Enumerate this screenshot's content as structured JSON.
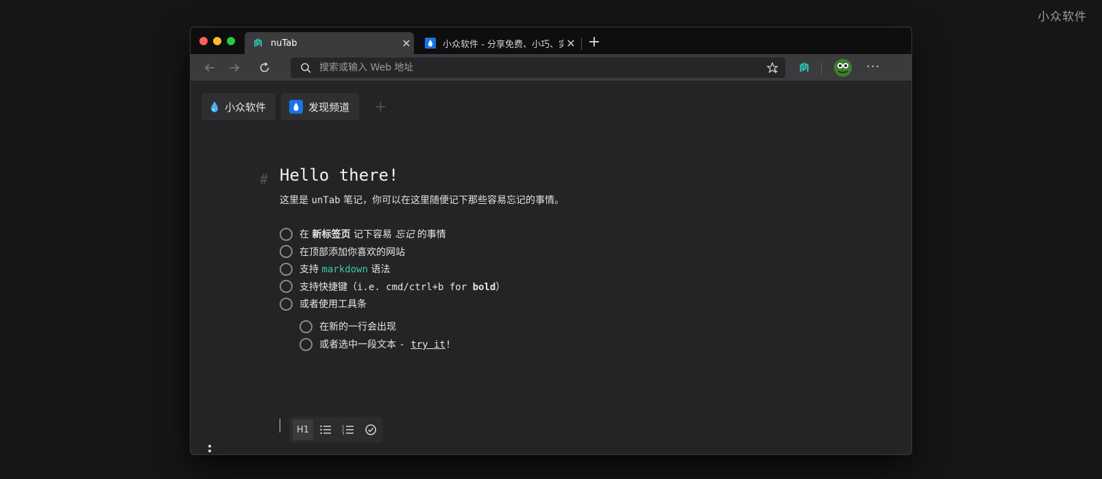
{
  "watermark": "小众软件",
  "tabs": [
    {
      "title": "nuTab",
      "icon": "nutab-logo-icon",
      "active": true
    },
    {
      "title": "小众软件 - 分享免费、小巧、实用",
      "icon": "appinn-drop-icon",
      "active": false
    }
  ],
  "toolbar": {
    "address_placeholder": "搜索或输入 Web 地址"
  },
  "bookmarks": [
    {
      "label": "小众软件",
      "icon": "water-drop-icon"
    },
    {
      "label": "发现频道",
      "icon": "water-drop-box-icon"
    }
  ],
  "note": {
    "hash": "#",
    "heading": "Hello there!",
    "intro_a": "这里是 ",
    "intro_mono": "unTab",
    "intro_b": " 笔记，你可以在这里随便记下那些容易忘记的事情。",
    "todos": [
      {
        "parts": [
          {
            "t": "在 ",
            "s": ""
          },
          {
            "t": "新标签页",
            "s": "bold"
          },
          {
            "t": " 记下容易 ",
            "s": ""
          },
          {
            "t": "忘记",
            "s": "italic"
          },
          {
            "t": " 的事情",
            "s": ""
          }
        ]
      },
      {
        "parts": [
          {
            "t": "在顶部添加你喜欢的网站",
            "s": ""
          }
        ]
      },
      {
        "parts": [
          {
            "t": "支持 ",
            "s": ""
          },
          {
            "t": "markdown",
            "s": "code"
          },
          {
            "t": " 语法",
            "s": ""
          }
        ]
      },
      {
        "parts": [
          {
            "t": "支持快捷键（",
            "s": ""
          },
          {
            "t": "i.e. cmd/ctrl+b for ",
            "s": "mono"
          },
          {
            "t": "bold",
            "s": "monobold"
          },
          {
            "t": "）",
            "s": ""
          }
        ]
      },
      {
        "parts": [
          {
            "t": "或者使用工具条",
            "s": ""
          }
        ]
      }
    ],
    "subtodos": [
      {
        "parts": [
          {
            "t": "在新的一行会出现",
            "s": ""
          }
        ]
      },
      {
        "parts": [
          {
            "t": "或者选中一段文本 ",
            "s": ""
          },
          {
            "t": "- ",
            "s": "mono"
          },
          {
            "t": "try it",
            "s": "underline"
          },
          {
            "t": "!",
            "s": "mono"
          }
        ]
      }
    ]
  },
  "format_toolbar": {
    "h1_label": "H1"
  },
  "colors": {
    "accent_green": "#3ec99e",
    "nutab_teal": "#2ec4b6",
    "appinn_blue": "#1a73e8"
  }
}
